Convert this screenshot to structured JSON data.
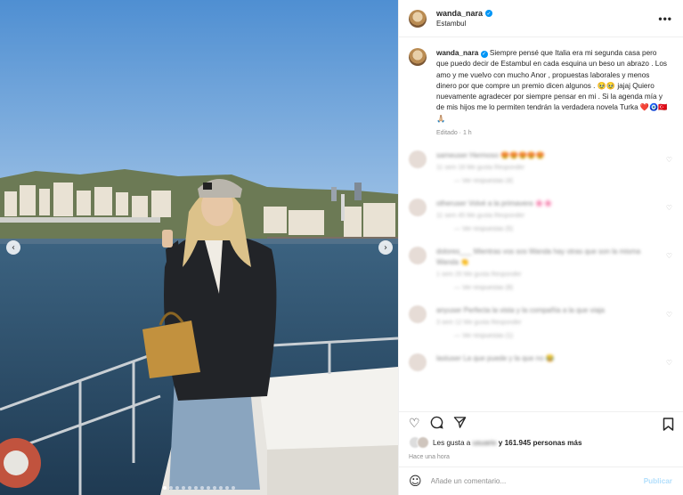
{
  "header": {
    "username": "wanda_nara",
    "location": "Estambul",
    "more_label": "•••"
  },
  "caption": {
    "username": "wanda_nara",
    "text": "Siempre pensé que Italia era mi segunda casa pero que puedo decir de Estambul en cada esquina un beso un abrazo . Los amo y me vuelvo con mucho Anor , propuestas laborales y menos dinero por que compre un premio dicen algunos . 🥹🥹 jajaj Quiero nuevamente agradecer por siempre pensar en mi . Si la agenda mía y de mis hijos me lo permiten tendrán la verdadera novela Turka ❤️🧿🇹🇷🙏🏼",
    "meta": "Editado · 1 h"
  },
  "comments": [
    {
      "text": "sameuser Hermoso 😍😍😍😍😍",
      "meta": "11 sem   18 Me gusta   Responder",
      "replies": "— Ver respuestas (4)"
    },
    {
      "text": "otheruser Volvé a la primavera 🌸🌸",
      "meta": "11 sem   45 Me gusta   Responder",
      "replies": "— Ver respuestas (5)"
    },
    {
      "text": "dolores___ Mientras vos sos Wanda hay otras que son la misma Wanda 👏",
      "meta": "1 sem   20 Me gusta   Responder",
      "replies": "— Ver respuestas (8)"
    },
    {
      "text": "anyuser Perfecta la vista y la compañía a la que viaja",
      "meta": "3 sem   12 Me gusta   Responder",
      "replies": "— Ver respuestas (1)"
    },
    {
      "text": "lastuser La que puede y la que no 😂",
      "meta": "",
      "replies": ""
    }
  ],
  "likes": {
    "prefix": "Les gusta a",
    "name": "usuario",
    "suffix": "y 161.945 personas más"
  },
  "timestamp": "Hace una hora",
  "add_comment": {
    "emoji": "☺",
    "placeholder": "Añade un comentario...",
    "publish": "Publicar"
  },
  "carousel": {
    "prev": "‹",
    "next": "›",
    "slides_count": 12,
    "active_index": 0
  },
  "colors": {
    "verified": "#0095f6",
    "publish_disabled": "#b2dffc",
    "sky": "#6fa3d6",
    "water": "#2d4f6a"
  }
}
